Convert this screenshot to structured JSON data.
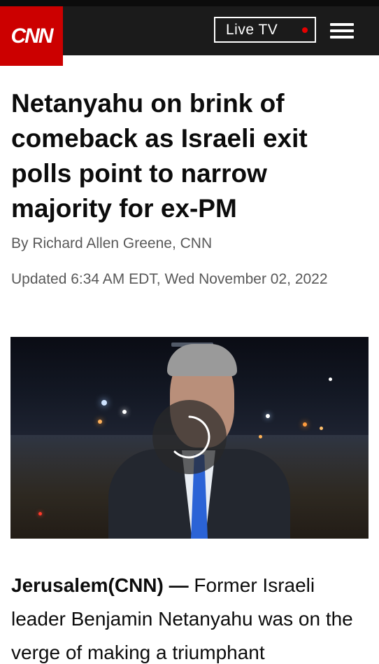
{
  "header": {
    "logo_text": "CNN",
    "live_tv_label": "Live TV",
    "brand_color": "#cc0000",
    "header_bg": "#1b1b1b",
    "live_indicator_color": "#e60000",
    "menu_icon": "hamburger-menu-icon"
  },
  "article": {
    "headline": "Netanyahu on brink of comeback as Israeli exit polls point to narrow majority for ex-PM",
    "byline": "By Richard Allen Greene, CNN",
    "updated": "Updated 6:34 AM EDT, Wed November 02, 2022",
    "video": {
      "overlay_icon": "loading-spinner-icon"
    },
    "body_lead": "Jerusalem(CNN) —",
    "body_text": " Former Israeli leader Benjamin Netanyahu was on the verge of making a triumphant"
  }
}
